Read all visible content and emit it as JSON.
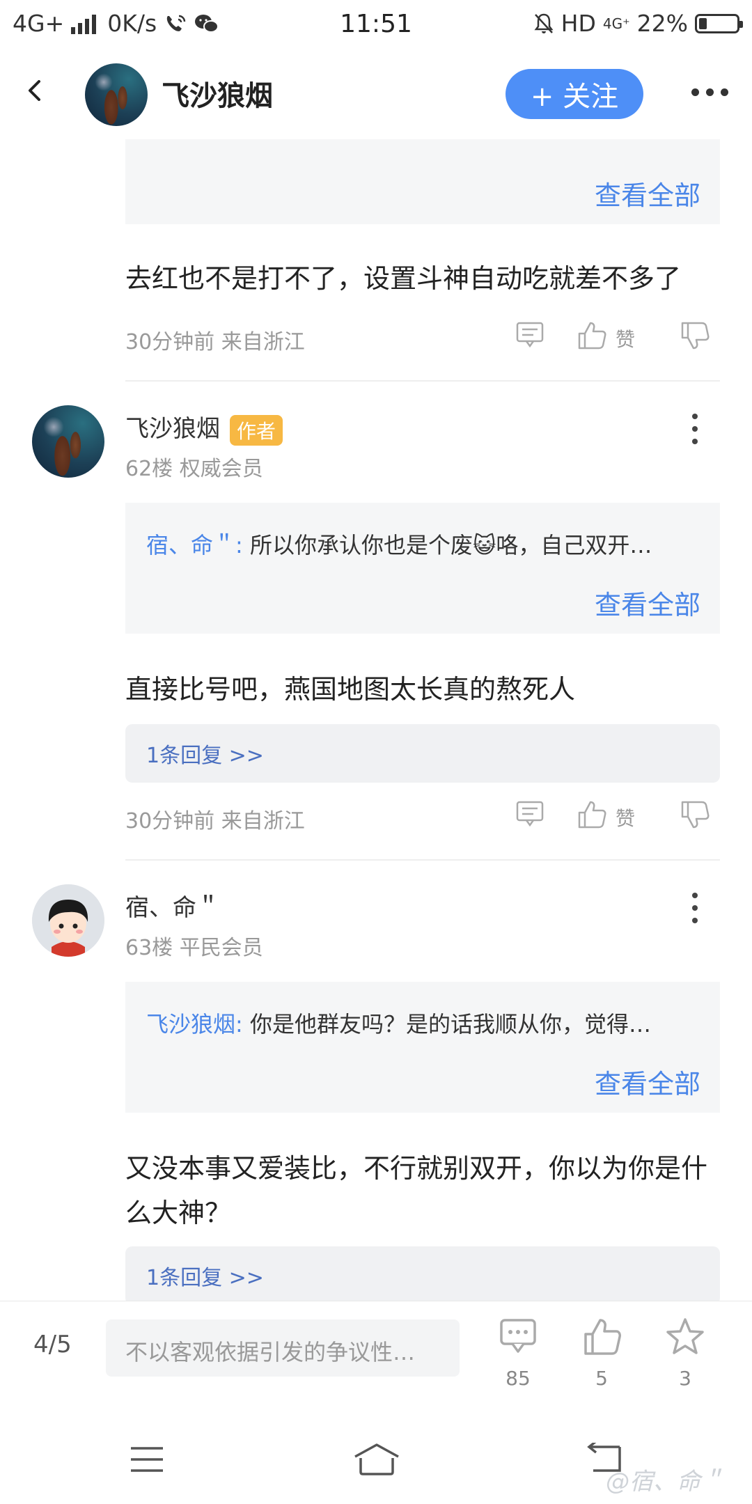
{
  "status_bar": {
    "network": "4G+",
    "speed": "0K/s",
    "time": "11:51",
    "hd": "HD",
    "network2": "4G⁺",
    "battery": "22%",
    "battery_level": 0.22
  },
  "header": {
    "title": "飞沙狼烟",
    "follow_label": "+ 关注"
  },
  "first_post": {
    "view_all": "查看全部",
    "text": "去红也不是打不了，设置斗神自动吃就差不多了",
    "meta": "30分钟前 来自浙江",
    "like_label": "赞"
  },
  "post2": {
    "username": "飞沙狼烟",
    "badge": "作者",
    "floor": "62楼 权威会员",
    "quote_author": "宿、命＂:",
    "quote_text": " 所以你承认你也是个废😺咯，自己双开…",
    "view_all": "查看全部",
    "text": "直接比号吧，燕国地图太长真的熬死人",
    "reply_label": "1条回复 >>",
    "meta": "30分钟前 来自浙江",
    "like_label": "赞"
  },
  "post3": {
    "username": "宿、命＂",
    "floor": "63楼 平民会员",
    "quote_author": "飞沙狼烟:",
    "quote_text": " 你是他群友吗？是的话我顺从你，觉得…",
    "view_all": "查看全部",
    "text": "又没本事又爱装比，不行就别双开，你以为你是什么大神？",
    "reply_label": "1条回复 >>"
  },
  "bottom_bar": {
    "page": "4/5",
    "input_placeholder": "不以客观依据引发的争议性…",
    "comments": "85",
    "likes": "5",
    "stars": "3"
  },
  "watermark": "@宿、命＂",
  "colors": {
    "accent": "#4e8ff7",
    "link": "#4a86e8",
    "badge": "#f7b843"
  }
}
